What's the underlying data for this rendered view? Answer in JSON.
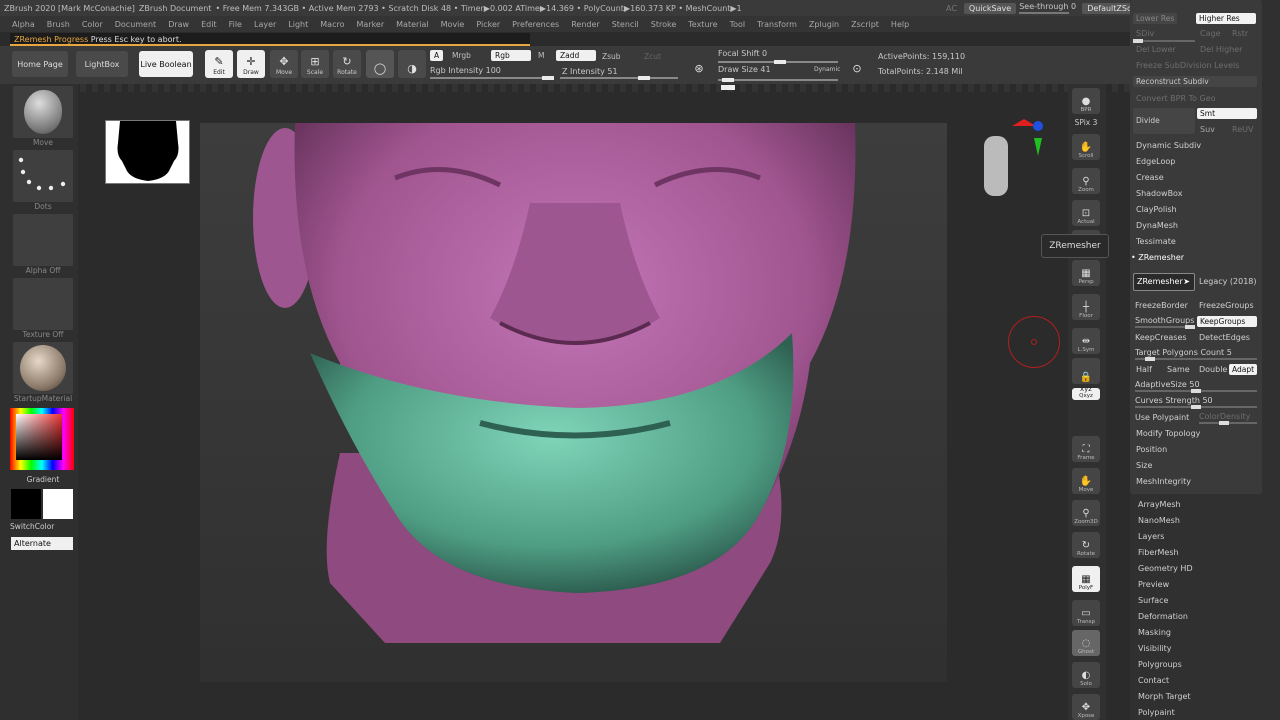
{
  "titlebar": {
    "app": "ZBrush 2020 [Mark McConachie]",
    "doc": "ZBrush Document",
    "stats": "• Free Mem 7.343GB • Active Mem 2793 • Scratch Disk 48 • Timer▶0.002 ATime▶14.369 • PolyCount▶160.373 KP • MeshCount▶1",
    "ac": "AC",
    "quicksave": "QuickSave",
    "seethrough": "See-through  0",
    "script": "DefaultZScript",
    "win_icons": [
      "≡",
      "⊡",
      "◧",
      "—",
      "❐",
      "✕"
    ]
  },
  "menu": [
    "Alpha",
    "Brush",
    "Color",
    "Document",
    "Draw",
    "Edit",
    "File",
    "Layer",
    "Light",
    "Macro",
    "Marker",
    "Material",
    "Movie",
    "Picker",
    "Preferences",
    "Render",
    "Stencil",
    "Stroke",
    "Texture",
    "Tool",
    "Transform",
    "Zplugin",
    "Zscript",
    "Help"
  ],
  "progress": {
    "label": "ZRemesh Progress",
    "msg": "  Press Esc key to abort."
  },
  "shelf": {
    "home": "Home Page",
    "lightbox": "LightBox",
    "liveboolean": "Live Boolean",
    "tools": [
      {
        "label": "Edit",
        "icon": "✎",
        "name": "edit"
      },
      {
        "label": "Draw",
        "icon": "✛",
        "name": "draw"
      },
      {
        "label": "Move",
        "icon": "✥",
        "name": "move"
      },
      {
        "label": "Scale",
        "icon": "⊞",
        "name": "scale"
      },
      {
        "label": "Rotate",
        "icon": "↻",
        "name": "rotate"
      }
    ],
    "a": "A",
    "mrgb": "Mrgb",
    "rgb": "Rgb",
    "m": "M",
    "zadd": "Zadd",
    "zsub": "Zsub",
    "zcut": "Zcut",
    "rgb_intensity": "Rgb Intensity 100",
    "z_intensity": "Z Intensity 51",
    "focal": "Focal Shift 0",
    "drawsize": "Draw Size 41",
    "dynamic": "Dynamic",
    "active_points": "ActivePoints: 159,110",
    "total_points": "TotalPoints: 2.148 Mil"
  },
  "lefttray": {
    "move": "Move",
    "dots": "Dots",
    "alpha": "Alpha Off",
    "texture": "Texture Off",
    "material": "StartupMaterial",
    "gradient": "Gradient",
    "switchcolor": "SwitchColor",
    "alternate": "Alternate"
  },
  "rshelf": [
    {
      "label": "BPR",
      "icon": "●",
      "name": "bpr"
    },
    {
      "label": "Scroll",
      "icon": "✋",
      "name": "scroll"
    },
    {
      "label": "Zoom",
      "icon": "⚲",
      "name": "zoom"
    },
    {
      "label": "Actual",
      "icon": "⊡",
      "name": "actual"
    },
    {
      "label": "AAHalf",
      "icon": "⊟",
      "name": "aahalf"
    },
    {
      "label": "Persp",
      "icon": "▦",
      "name": "persp"
    },
    {
      "label": "Floor",
      "icon": "┼",
      "name": "floor"
    },
    {
      "label": "L.Sym",
      "icon": "⇹",
      "name": "lsym"
    },
    {
      "label": "",
      "icon": "🔒",
      "name": "lock"
    },
    {
      "label": "Qxyz",
      "icon": "xyz",
      "name": "qxyz"
    },
    {
      "label": "Frame",
      "icon": "⛶",
      "name": "frame"
    },
    {
      "label": "Move",
      "icon": "✋",
      "name": "move"
    },
    {
      "label": "Zoom3D",
      "icon": "⚲",
      "name": "zoom3d"
    },
    {
      "label": "Rotate",
      "icon": "↻",
      "name": "rotate"
    },
    {
      "label": "PolyF",
      "icon": "▦",
      "name": "polyf"
    },
    {
      "label": "Transp",
      "icon": "▭",
      "name": "transp"
    },
    {
      "label": "Ghost",
      "icon": "◌",
      "name": "ghost"
    },
    {
      "label": "Solo",
      "icon": "◐",
      "name": "solo"
    },
    {
      "label": "Xpose",
      "icon": "✥",
      "name": "xpose"
    }
  ],
  "spix": "SPix 3",
  "tooltip": "ZRemesher",
  "rpanel": {
    "lower_res": "Lower Res",
    "higher_res": "Higher Res",
    "cage": "Cage",
    "rstr": "Rstr",
    "del_lower": "Del Lower",
    "del_higher": "Del Higher",
    "freeze_subdiv": "Freeze SubDivision Levels",
    "reconstruct": "Reconstruct Subdiv",
    "convert_bpr": "Convert BPR To Geo",
    "divide": "Divide",
    "smt": "Smt",
    "suv": "Suv",
    "reuv": "ReUV",
    "dynamic_subdiv": "Dynamic Subdiv",
    "edgeloop": "EdgeLoop",
    "crease": "Crease",
    "shadowbox": "ShadowBox",
    "claypolish": "ClayPolish",
    "dynamesh": "DynaMesh",
    "tessimate": "Tessimate",
    "zremesher_header": "• ZRemesher",
    "zremesher_btn": "ZRemesher",
    "legacy": "Legacy (2018)",
    "freezeborder": "FreezeBorder",
    "freezegroups": "FreezeGroups",
    "smoothgroups": "SmoothGroups",
    "keepgroups": "KeepGroups",
    "keepcreases": "KeepCreases",
    "detectedges": "DetectEdges",
    "target": "Target Polygons Count 5",
    "half": "Half",
    "same": "Same",
    "double": "Double",
    "adapt": "Adapt",
    "adaptivesize": "AdaptiveSize 50",
    "curves": "Curves Strength 50",
    "usepolypaint": "Use Polypaint",
    "colordensity": "ColorDensity",
    "modify": "Modify Topology",
    "position": "Position",
    "size": "Size",
    "meshintegrity": "MeshIntegrity"
  },
  "lower": [
    "ArrayMesh",
    "NanoMesh",
    "Layers",
    "FiberMesh",
    "Geometry HD",
    "Preview",
    "Surface",
    "Deformation",
    "Masking",
    "Visibility",
    "Polygroups",
    "Contact",
    "Morph Target",
    "Polypaint"
  ],
  "colors": {
    "accent": "#e8a640",
    "pink": "#b25fa5",
    "green": "#5fb799"
  }
}
